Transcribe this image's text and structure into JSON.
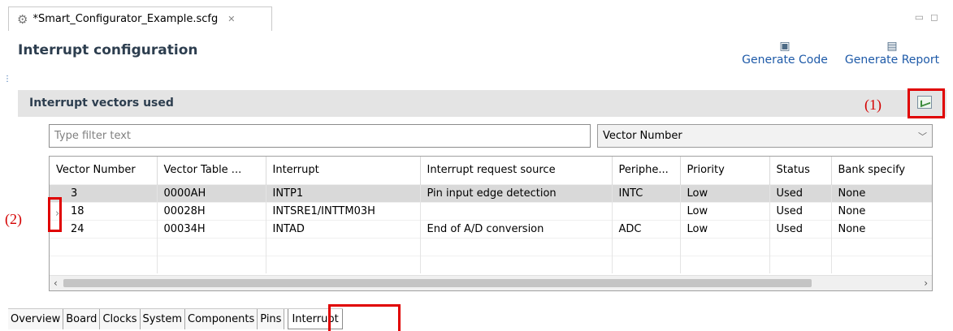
{
  "editor_tab": {
    "title": "*Smart_Configurator_Example.scfg",
    "close": "✕"
  },
  "window_controls": {
    "minimize": "▭",
    "maximize": "◻"
  },
  "header": {
    "title": "Interrupt configuration",
    "generate_code": "Generate Code",
    "generate_report": "Generate Report"
  },
  "section": {
    "title": "Interrupt vectors used",
    "annotation_1": "(1)",
    "annotation_2": "(2)"
  },
  "filter": {
    "placeholder": "Type filter text",
    "selected_column": "Vector Number"
  },
  "table": {
    "headers": [
      "Vector Number",
      "Vector Table ...",
      "Interrupt",
      "Interrupt request source",
      "Periphe...",
      "Priority",
      "Status",
      "Bank specify"
    ],
    "rows": [
      [
        "3",
        "0000AH",
        "INTP1",
        "Pin input edge detection",
        "INTC",
        "Low",
        "Used",
        "None"
      ],
      [
        "18",
        "00028H",
        "INTSRE1/INTTM03H",
        "",
        "",
        "Low",
        "Used",
        "None"
      ],
      [
        "24",
        "00034H",
        "INTAD",
        "End of A/D conversion",
        "ADC",
        "Low",
        "Used",
        "None"
      ]
    ]
  },
  "bottom_tabs": [
    "Overview",
    "Board",
    "Clocks",
    "System",
    "Components",
    "Pins",
    "Interrupt"
  ],
  "active_tab": "Interrupt",
  "colors": {
    "highlight": "#e00000",
    "link": "#1e5aa8",
    "selected_row": "#d9d9d9"
  }
}
